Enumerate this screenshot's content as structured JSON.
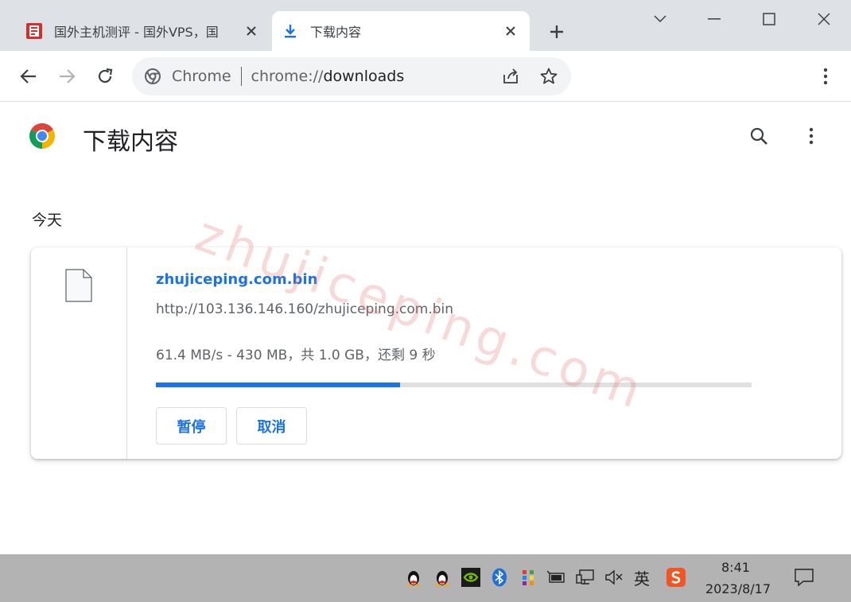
{
  "browser": {
    "tabs": [
      {
        "title": "国外主机测评 - 国外VPS，国",
        "active": false,
        "icon": "site-favicon-icon"
      },
      {
        "title": "下载内容",
        "active": true,
        "icon": "download-icon"
      }
    ],
    "omnibox": {
      "site_label": "Chrome",
      "url_scheme": "chrome://",
      "url_path": "downloads"
    }
  },
  "page": {
    "title": "下载内容",
    "section_date": "今天",
    "watermark": "zhujiceping.com"
  },
  "download": {
    "file_name": "zhujiceping.com.bin",
    "url": "http://103.136.146.160/zhujiceping.com.bin",
    "status": "61.4 MB/s - 430 MB，共 1.0 GB，还剩 9 秒",
    "progress_fraction": 0.41,
    "pause_label": "暂停",
    "cancel_label": "取消"
  },
  "taskbar": {
    "ime_label": "英",
    "time": "8:41",
    "date": "2023/8/17"
  },
  "colors": {
    "accent": "#1a73e8",
    "tabstrip": "#dee1e6",
    "taskbar": "#b3b3b3"
  }
}
